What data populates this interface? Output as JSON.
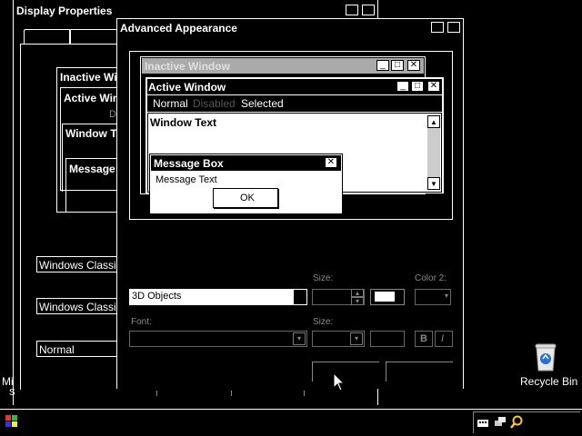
{
  "display_props": {
    "title": "Display Properties",
    "theme_select": "Windows Classic",
    "color_scheme_select": "Windows Classic",
    "font_size_select": "Normal",
    "preview_inactive": "Inactive Wi",
    "preview_active": "Active Win",
    "preview_disabled": "D",
    "preview_window_text": "Window Te",
    "preview_message": "Message"
  },
  "advanced": {
    "title": "Advanced Appearance",
    "preview": {
      "inactive_title": "Inactive Window",
      "active_title": "Active Window",
      "menu_normal": "Normal",
      "menu_disabled": "Disabled",
      "menu_selected": "Selected",
      "window_text": "Window Text",
      "msgbox_title": "Message Box",
      "msgbox_text": "Message Text",
      "ok_label": "OK"
    },
    "item_value": "3D Objects",
    "size_label": "Size:",
    "color2_label": "Color 2:",
    "font_label": "Font:",
    "font_size_label": "Size:",
    "bold_label": "B",
    "italic_label": "I"
  },
  "desktop": {
    "recycle_bin_label": "Recycle Bin",
    "left_fragment_1": "Mi",
    "left_fragment_2": "S"
  },
  "colors": {
    "background": "#000000",
    "foreground": "#ffffff",
    "disabled_text": "#8a8a8a",
    "desktop_icon_blue": "#2a6fd6"
  }
}
